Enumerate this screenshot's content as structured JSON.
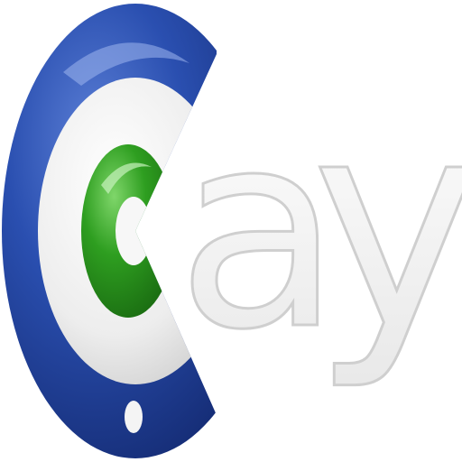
{
  "logo": {
    "text": "cay",
    "letter_a": "a",
    "letter_y": "y",
    "icon": "c-ring-logo-icon",
    "colors": {
      "outer_ring": "#1e3f9a",
      "outer_ring_highlight": "#5b7fd6",
      "middle_ring": "#f2f2f2",
      "inner_ring": "#2a9b1d",
      "inner_ring_highlight": "#7fd66a",
      "letters_fill": "#f4f4f4",
      "letters_stroke": "#cfcfcf"
    }
  }
}
